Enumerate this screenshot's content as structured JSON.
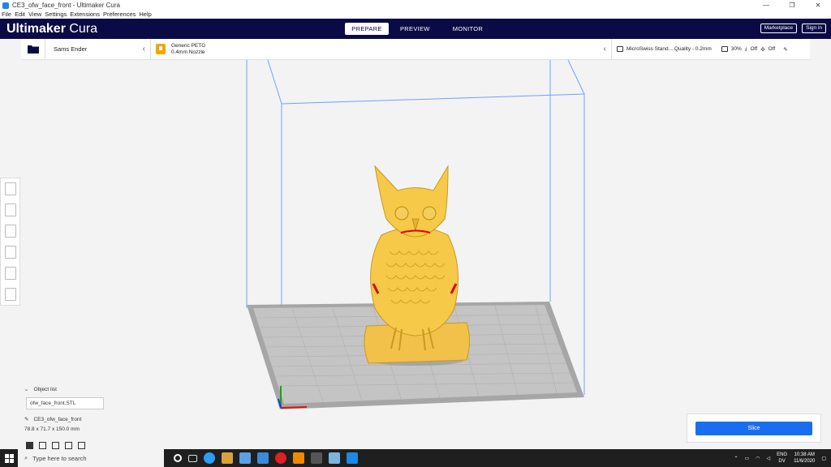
{
  "window": {
    "title": "CE3_ofw_face_front - Ultimaker Cura",
    "controls": [
      "—",
      "❐",
      "✕"
    ]
  },
  "menu": [
    "File",
    "Edit",
    "View",
    "Settings",
    "Extensions",
    "Preferences",
    "Help"
  ],
  "header": {
    "brand_bold": "Ultimaker",
    "brand_light": " Cura",
    "stages": [
      "PREPARE",
      "PREVIEW",
      "MONITOR"
    ],
    "active_stage": "PREPARE",
    "marketplace": "Marketplace",
    "signin": "Sign in"
  },
  "toolbar": {
    "printer": "Sams Ender",
    "material_name": "Generic PETG",
    "nozzle": "0.4mm Nozzle",
    "profile": "MicroSwiss Stand... Quality - 0.2mm",
    "infill": "30%",
    "support": "Off",
    "adhesion": "Off"
  },
  "objects": {
    "header": "Object list",
    "file": "ofw_face_front.STL",
    "project": "CE3_ofw_face_front",
    "dimensions": "78.8 x 71.7 x 150.0 mm"
  },
  "slice": {
    "label": "Slice"
  },
  "taskbar": {
    "search_placeholder": "Type here to search",
    "lang_top": "ENG",
    "lang_bottom": "DV",
    "time": "10:38 AM",
    "date": "11/6/2020"
  },
  "colors": {
    "header_bg": "#0a0b45",
    "accent": "#196ef0",
    "model": "#f7c948",
    "build_volume": "#6fa0ff"
  }
}
